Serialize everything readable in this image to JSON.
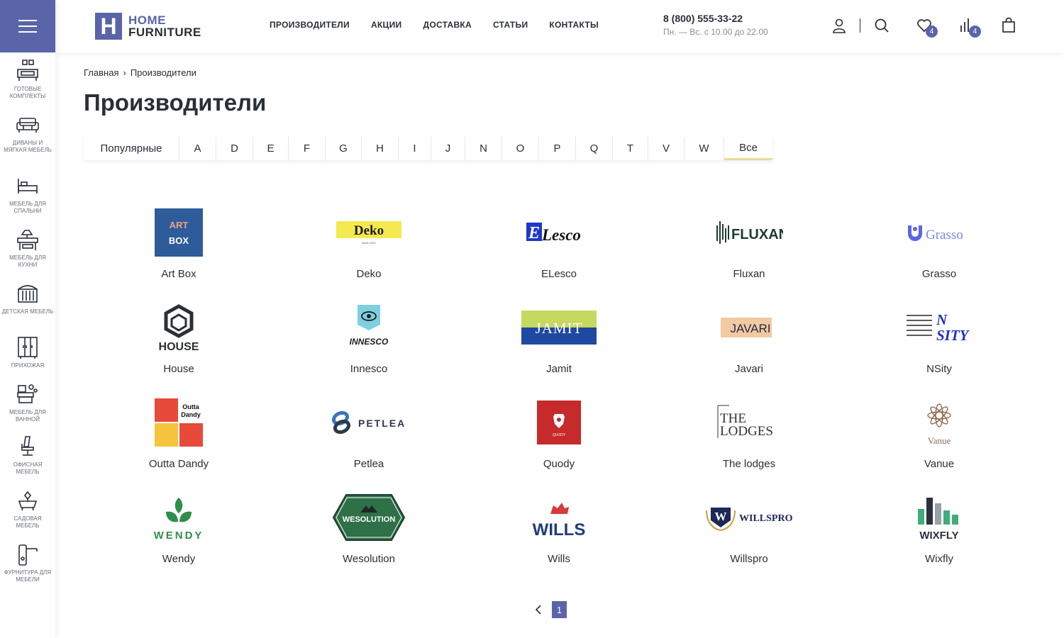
{
  "sidebar": {
    "menu_icon": "hamburger-icon",
    "items": [
      {
        "label": "ГОТОВЫЕ КОМПЛЕКТЫ",
        "icon": "furniture-set-icon"
      },
      {
        "label": "ДИВАНЫ И МЯГКАЯ МЕБЕЛЬ",
        "icon": "sofa-icon"
      },
      {
        "label": "МЕБЕЛЬ ДЛЯ СПАЛЬНИ",
        "icon": "bed-icon"
      },
      {
        "label": "МЕБЕЛЬ ДЛЯ КУХНИ",
        "icon": "kitchen-icon"
      },
      {
        "label": "ДЕТСКАЯ МЕБЕЛЬ",
        "icon": "crib-icon"
      },
      {
        "label": "ПРИХОЖАЯ",
        "icon": "wardrobe-icon"
      },
      {
        "label": "МЕБЕЛЬ ДЛЯ ВАННОЙ",
        "icon": "bathroom-icon"
      },
      {
        "label": "ОФИСНАЯ МЕБЕЛЬ",
        "icon": "office-chair-icon"
      },
      {
        "label": "САДОВАЯ МЕБЕЛЬ",
        "icon": "garden-icon"
      },
      {
        "label": "ФУРНИТУРА ДЛЯ МЕБЕЛИ",
        "icon": "door-handle-icon"
      }
    ]
  },
  "header": {
    "logo": {
      "mark": "H",
      "line1": "HOME",
      "line2": "FURNITURE"
    },
    "nav": [
      "ПРОИЗВОДИТЕЛИ",
      "АКЦИИ",
      "ДОСТАВКА",
      "СТАТЬИ",
      "КОНТАКТЫ"
    ],
    "phone": "8 (800) 555-33-22",
    "hours": "Пн. — Вс. с 10.00 до 22.00",
    "favorites_count": "4",
    "compare_count": "4",
    "colors": {
      "accent": "#5a64a8",
      "text": "#2b2e3a",
      "active_underline": "#e8de97"
    }
  },
  "breadcrumb": {
    "home": "Главная",
    "separator": "›",
    "current": "Производители"
  },
  "title": "Производители",
  "letters": [
    "Популярные",
    "A",
    "D",
    "E",
    "F",
    "G",
    "H",
    "I",
    "J",
    "N",
    "O",
    "P",
    "Q",
    "T",
    "V",
    "W",
    "Все"
  ],
  "active_letter": "Все",
  "brands": [
    {
      "name": "Art Box",
      "logo_text": [
        "ART",
        "BOX"
      ]
    },
    {
      "name": "Deko",
      "logo_text": [
        "Deko",
        "since 2001"
      ]
    },
    {
      "name": "ELesco",
      "logo_text": [
        "E",
        "Lesco"
      ]
    },
    {
      "name": "Fluxan",
      "logo_text": [
        "FLUXAN"
      ]
    },
    {
      "name": "Grasso",
      "logo_text": [
        "Grasso"
      ]
    },
    {
      "name": "House",
      "logo_text": [
        "HOUSE"
      ]
    },
    {
      "name": "Innesco",
      "logo_text": [
        "INNESCO"
      ]
    },
    {
      "name": "Jamit",
      "logo_text": [
        "JAMIT"
      ]
    },
    {
      "name": "Javari",
      "logo_text": [
        "JAVARI"
      ]
    },
    {
      "name": "NSity",
      "logo_text": [
        "N",
        "SITY"
      ]
    },
    {
      "name": "Outta Dandy",
      "logo_text": [
        "Outta",
        "Dandy"
      ]
    },
    {
      "name": "Petlea",
      "logo_text": [
        "PETLEA"
      ]
    },
    {
      "name": "Quody",
      "logo_text": [
        "QUODY"
      ]
    },
    {
      "name": "The lodges",
      "logo_text": [
        "THE",
        "LODGES"
      ]
    },
    {
      "name": "Vanue",
      "logo_text": [
        "Vanue"
      ]
    },
    {
      "name": "Wendy",
      "logo_text": [
        "WENDY"
      ]
    },
    {
      "name": "Wesolution",
      "logo_text": [
        "WESOLUTION"
      ]
    },
    {
      "name": "Wills",
      "logo_text": [
        "WILLS"
      ]
    },
    {
      "name": "Willspro",
      "logo_text": [
        "W",
        "WILLSPRO"
      ]
    },
    {
      "name": "Wixfly",
      "logo_text": [
        "WIXFLY"
      ]
    }
  ],
  "pagination": {
    "current": "1",
    "prev_icon": "chevron-left-icon"
  }
}
